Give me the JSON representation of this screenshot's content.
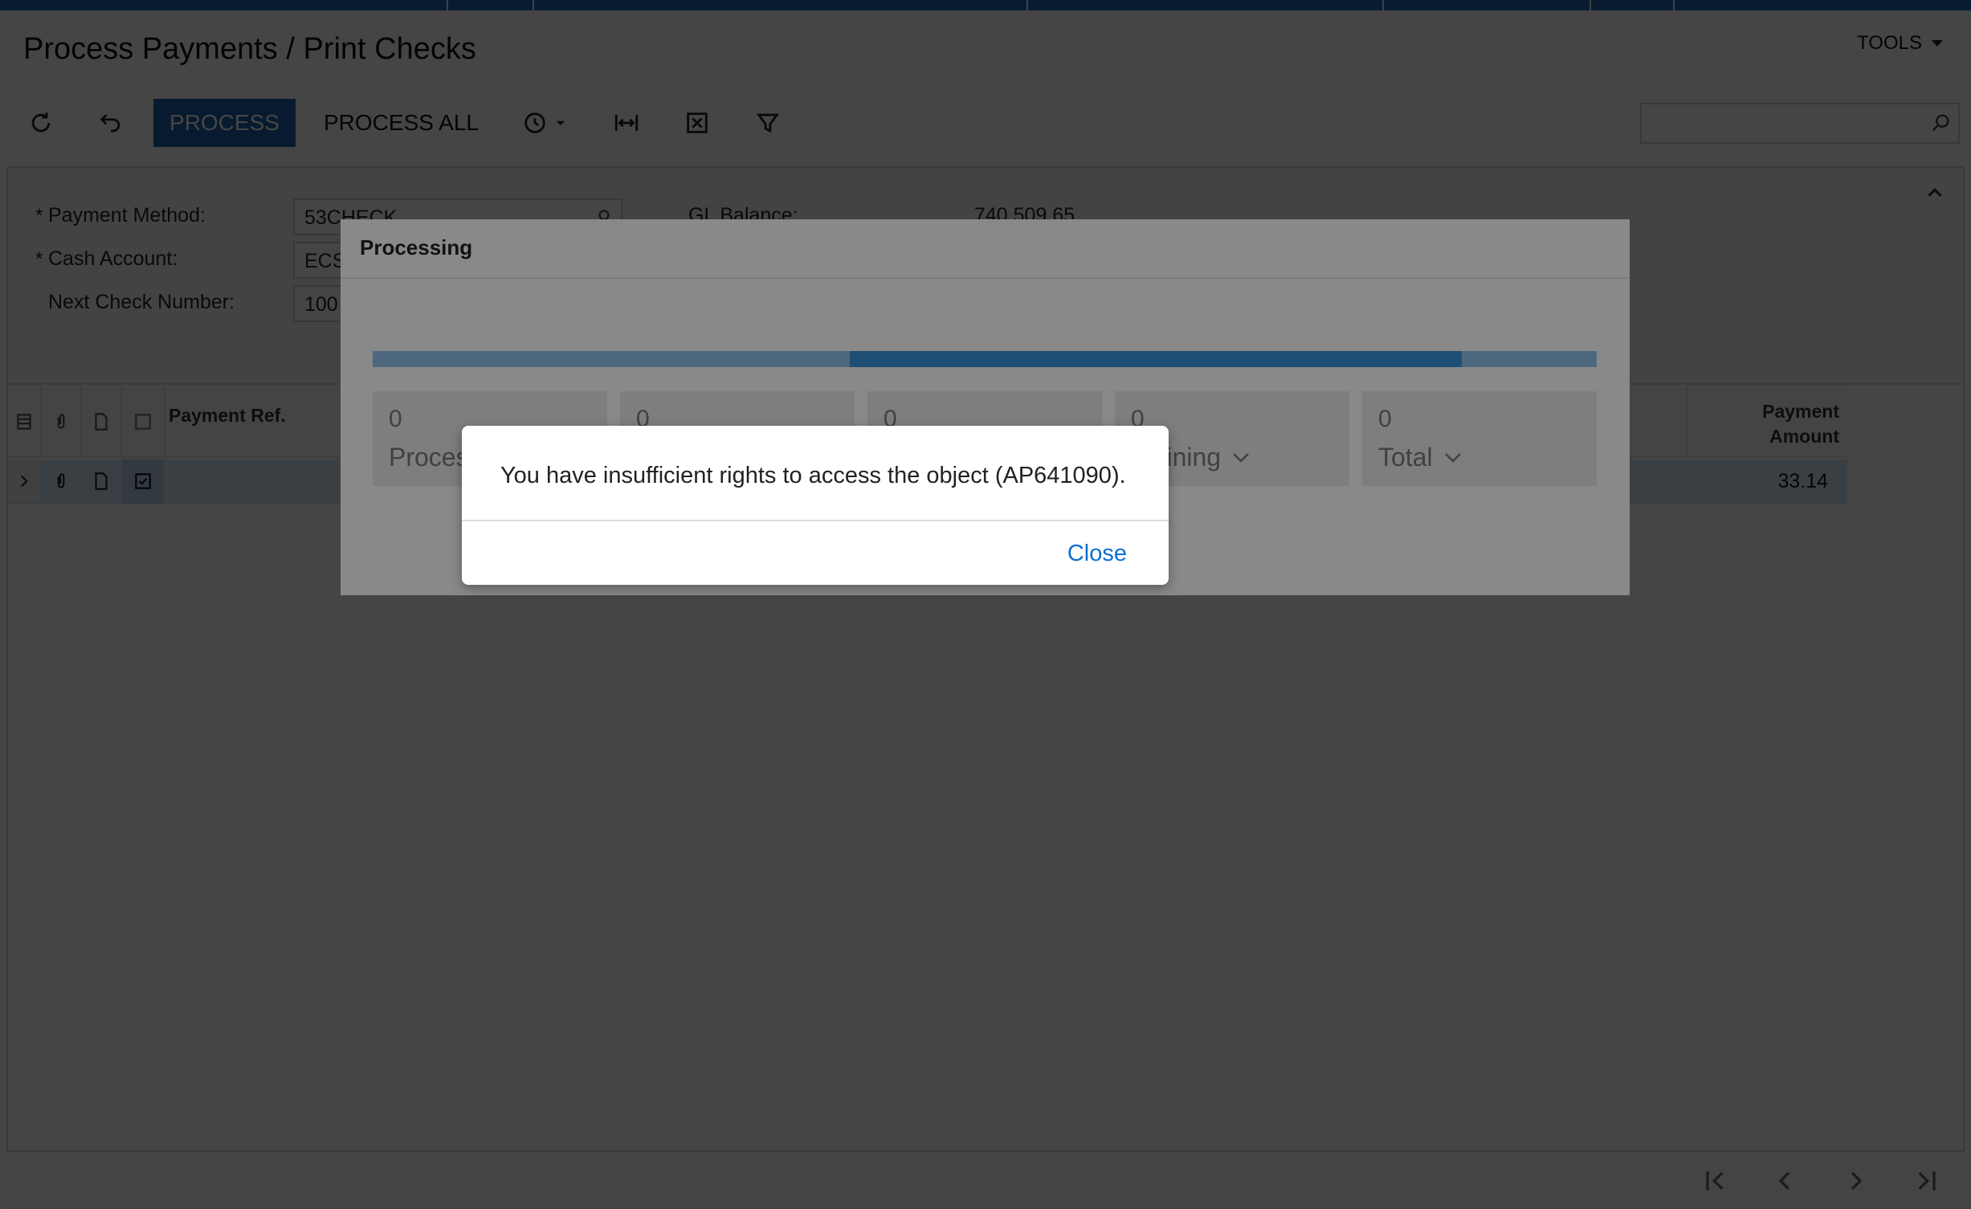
{
  "header": {
    "title": "Process Payments / Print Checks",
    "tools_label": "TOOLS"
  },
  "toolbar": {
    "process_label": "PROCESS",
    "process_all_label": "PROCESS ALL",
    "icons": [
      "refresh-icon",
      "undo-icon",
      "schedule-icon",
      "fit-width-icon",
      "excel-export-icon",
      "filter-icon"
    ],
    "search_placeholder": ""
  },
  "form": {
    "payment_method_label": "Payment Method:",
    "payment_method_value": "53CHECK",
    "cash_account_label": "Cash Account:",
    "cash_account_value": "ECS",
    "next_check_label": "Next Check Number:",
    "next_check_value": "100",
    "gl_balance_label": "GL Balance:",
    "gl_balance_value": "740,509.65",
    "required_mark": "*"
  },
  "grid": {
    "columns": {
      "payment_ref": "Payment Ref.",
      "payment_amount_line1": "Payment",
      "payment_amount_line2": "Amount"
    },
    "rows": [
      {
        "selected": true,
        "payment_amount": "33.14"
      }
    ]
  },
  "processing_dialog": {
    "title": "Processing",
    "progress_segments": [
      {
        "from": 0.0,
        "to": 0.39,
        "color": "#8dbde6"
      },
      {
        "from": 0.39,
        "to": 0.89,
        "color": "#3a8fd6"
      },
      {
        "from": 0.89,
        "to": 1.0,
        "color": "#8dbde6"
      }
    ],
    "stats": [
      {
        "value": "0",
        "label": "Proces"
      },
      {
        "value": "0",
        "label": ""
      },
      {
        "value": "0",
        "label": ""
      },
      {
        "value": "0",
        "label": "maining"
      },
      {
        "value": "0",
        "label": "Total"
      }
    ]
  },
  "alert": {
    "message": "You have insufficient rights to access the object (AP641090).",
    "close_label": "Close"
  }
}
